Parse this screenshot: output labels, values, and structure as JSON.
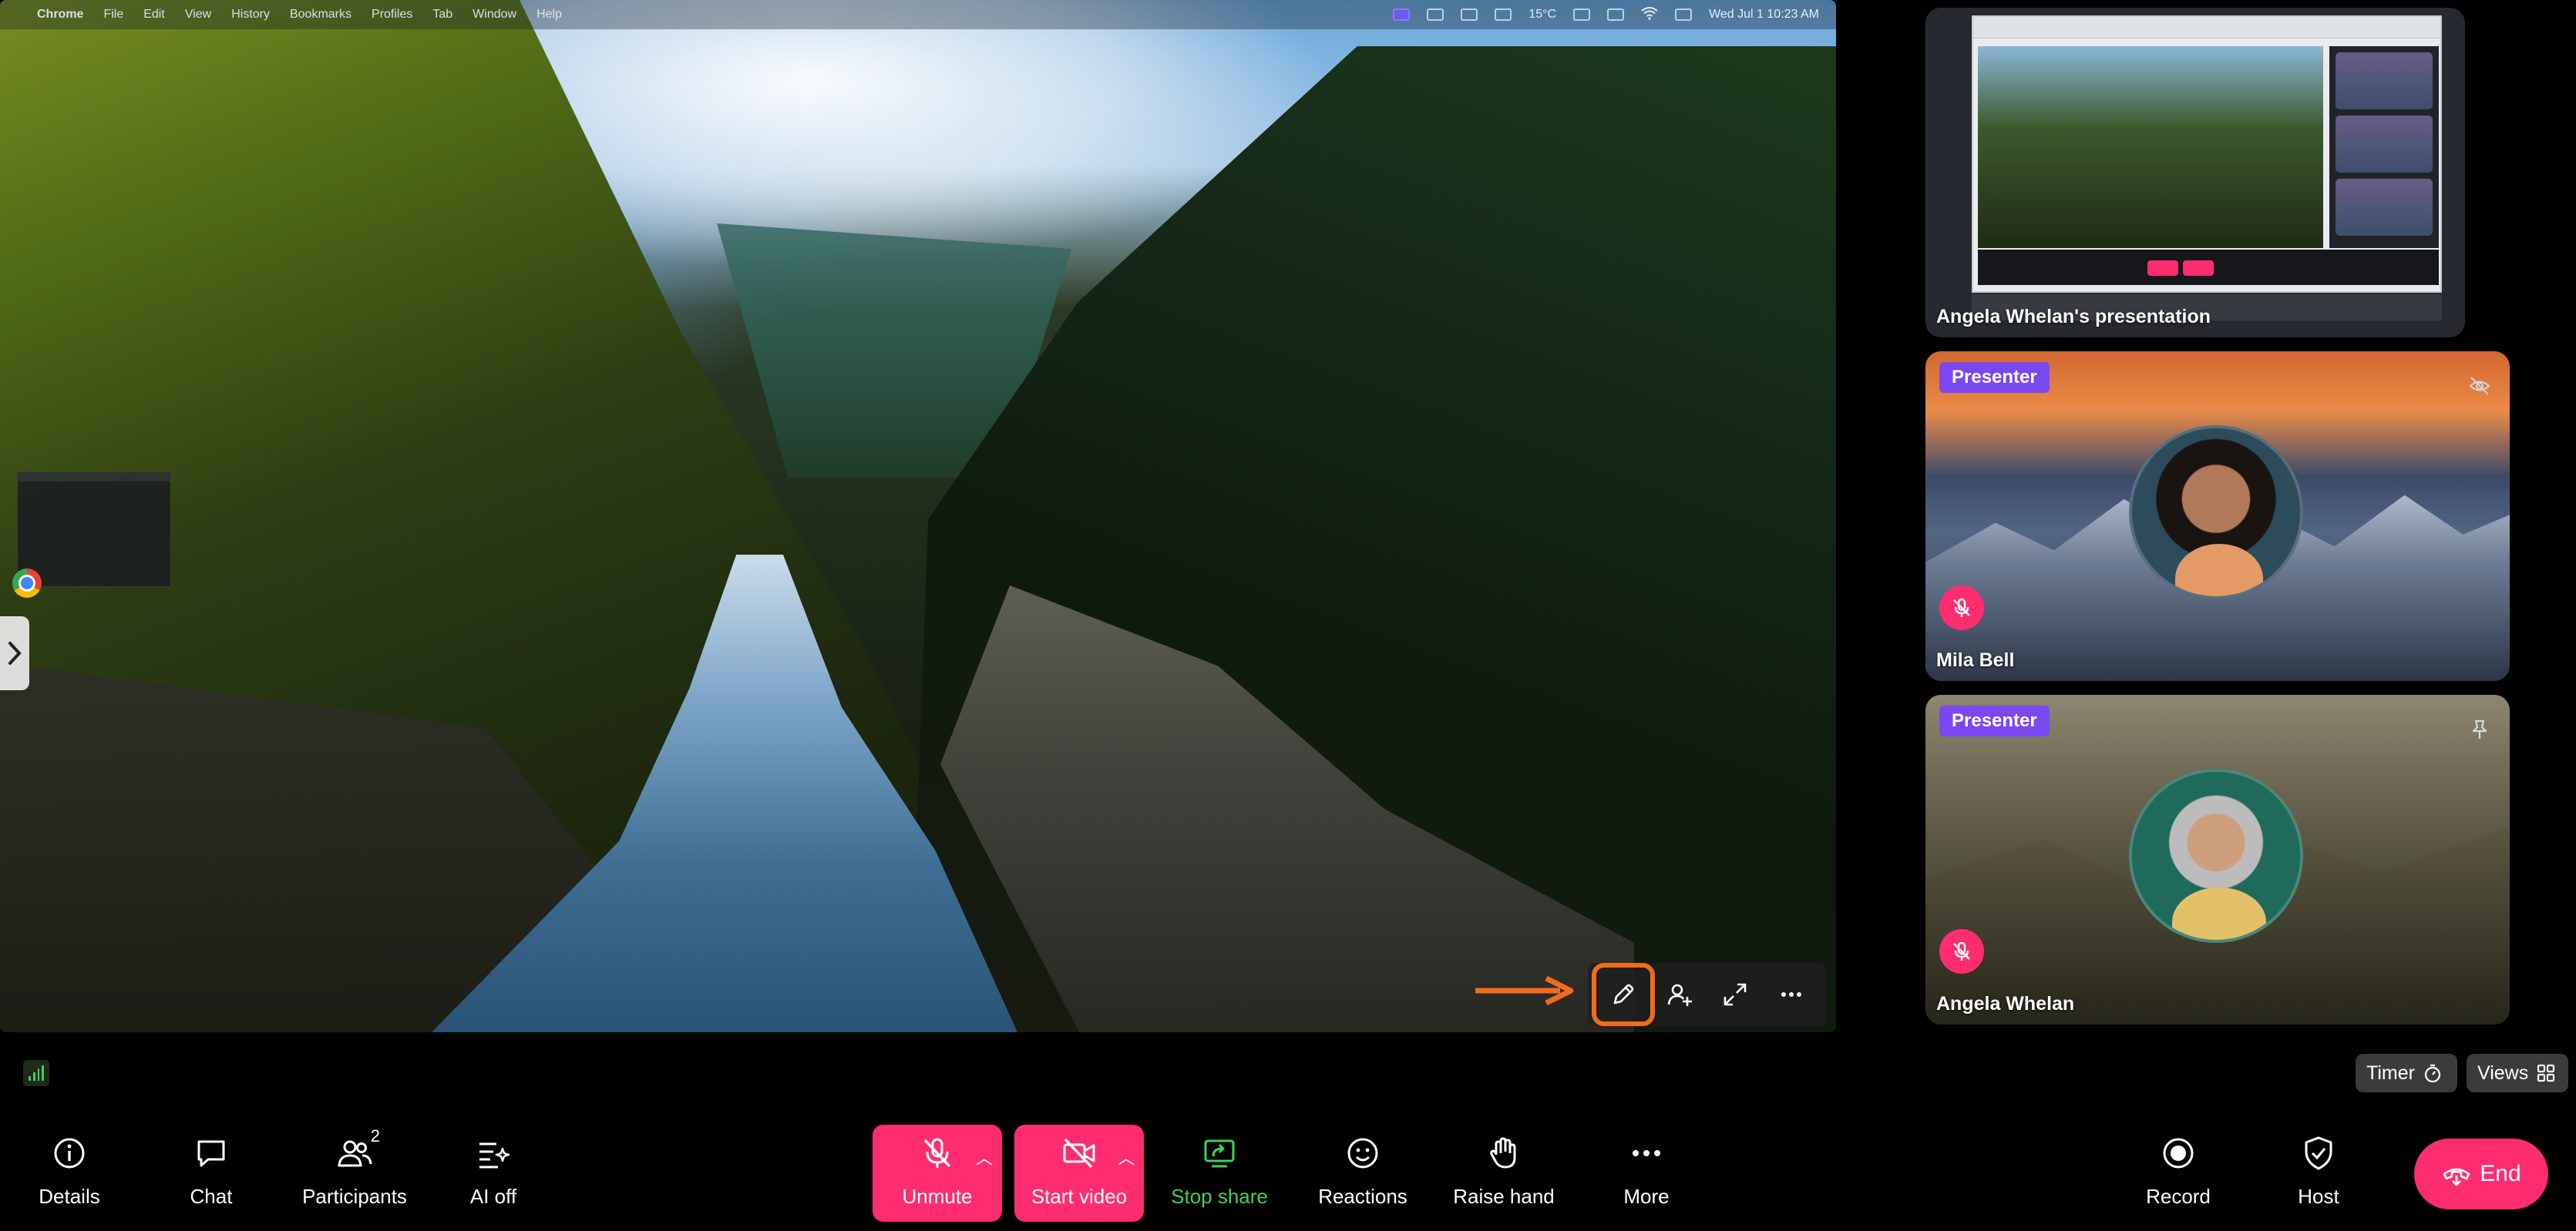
{
  "mac_menubar": {
    "app": "Chrome",
    "items": [
      "File",
      "Edit",
      "View",
      "History",
      "Bookmarks",
      "Profiles",
      "Tab",
      "Window",
      "Help"
    ],
    "temperature": "15°C",
    "datetime": "Wed Jul 1  10:23 AM"
  },
  "stage": {
    "toolbar": {
      "annotate_icon": "pencil-icon",
      "invite_icon": "add-person-icon",
      "fullscreen_icon": "expand-icon",
      "more_icon": "ellipsis-icon"
    },
    "callout_color": "#f26b1d"
  },
  "tiles": [
    {
      "name": "Angela Whelan's presentation"
    },
    {
      "name": "Mila Bell",
      "badge": "Presenter",
      "muted": true
    },
    {
      "name": "Angela Whelan",
      "badge": "Presenter",
      "muted": true
    }
  ],
  "secondary": {
    "timer_label": "Timer",
    "views_label": "Views"
  },
  "controls": {
    "details": "Details",
    "chat": "Chat",
    "participants": "Participants",
    "participants_count": "2",
    "ai": "AI off",
    "unmute": "Unmute",
    "start_video": "Start video",
    "stop_share": "Stop share",
    "reactions": "Reactions",
    "raise_hand": "Raise hand",
    "more": "More",
    "record": "Record",
    "host": "Host",
    "end": "End"
  },
  "colors": {
    "accent": "#ff2d6f",
    "presenter_badge": "#7b48f0",
    "share_green": "#3fd15a"
  }
}
